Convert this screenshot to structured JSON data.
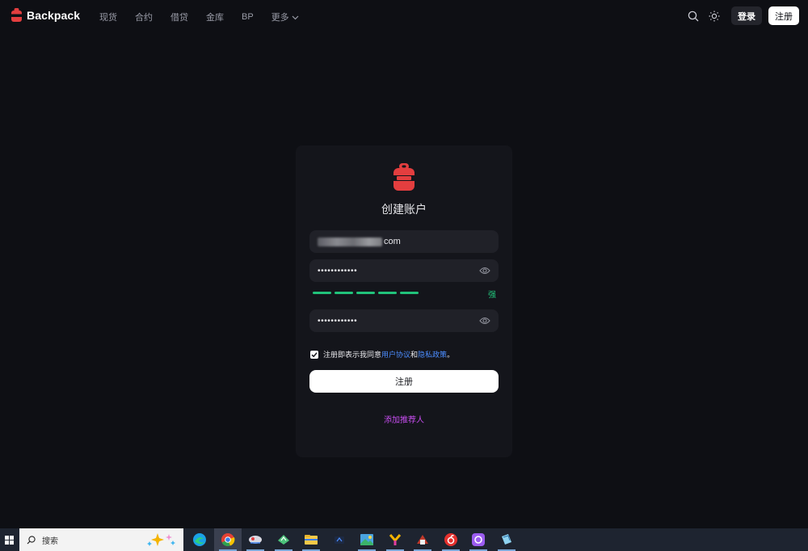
{
  "brand": {
    "name": "Backpack",
    "color": "#e33e3f"
  },
  "nav": {
    "items": [
      "现货",
      "合约",
      "借贷",
      "金库",
      "BP",
      "更多"
    ]
  },
  "header": {
    "search_icon": "search-icon",
    "theme_icon": "sun-icon",
    "login_label": "登录",
    "signup_label": "注册"
  },
  "card": {
    "title": "创建账户",
    "email_value_suffix": "com",
    "password_mask": "••••••••••••",
    "confirm_mask": "••••••••••••",
    "strength_label": "强",
    "strength_color": "#21c27a",
    "agree_prefix": "注册即表示我同意",
    "agree_link1": "用户协议",
    "agree_and": "和",
    "agree_link2": "隐私政策",
    "agree_suffix": "。",
    "submit_label": "注册",
    "referral_label": "添加推荐人",
    "link_color": "#4c8dff",
    "referral_color": "#c74df0"
  },
  "taskbar": {
    "search_placeholder": "搜索",
    "apps": [
      "edge-icon",
      "chrome-icon",
      "app3-icon",
      "app4-icon",
      "file-explorer-icon",
      "app6-icon",
      "photos-icon",
      "app8-icon",
      "app9-icon",
      "netease-music-icon",
      "app11-icon",
      "app12-icon"
    ]
  }
}
